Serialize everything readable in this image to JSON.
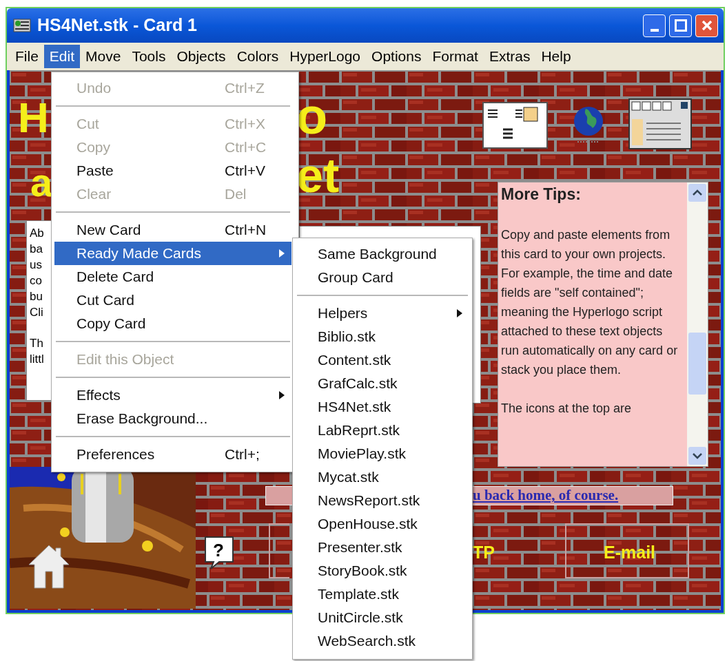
{
  "window": {
    "title": "HS4Net.stk - Card 1"
  },
  "menu_bar": [
    {
      "label": "File",
      "selected": false
    },
    {
      "label": "Edit",
      "selected": true
    },
    {
      "label": "Move",
      "selected": false
    },
    {
      "label": "Tools",
      "selected": false
    },
    {
      "label": "Objects",
      "selected": false
    },
    {
      "label": "Colors",
      "selected": false
    },
    {
      "label": "HyperLogo",
      "selected": false
    },
    {
      "label": "Options",
      "selected": false
    },
    {
      "label": "Format",
      "selected": false
    },
    {
      "label": "Extras",
      "selected": false
    },
    {
      "label": "Help",
      "selected": false
    }
  ],
  "card": {
    "title_fragments": [
      "H",
      "o",
      "a",
      "et"
    ],
    "text_field": [
      [
        "Ab",
        "ba",
        "us",
        "co",
        "bu",
        "Cli"
      ],
      [
        "Th",
        "littl"
      ]
    ],
    "tips": {
      "title": "More Tips:",
      "blocks": [
        [
          "Copy and paste elements from this card to your own projects.",
          "For example, the time and date fields are \"self contained\"; meaning the Hyperlogo script attached to these text objects run automatically on any card or stack you place them."
        ],
        [
          "The icons at the top are"
        ]
      ]
    },
    "link_text": "u back home, of course.",
    "buttons": [
      "TP",
      "E-mail"
    ],
    "help_mark": "?"
  },
  "edit_menu": {
    "items": [
      {
        "kind": "item",
        "label": "Undo",
        "shortcut": "Ctrl+Z",
        "disabled": true,
        "selected": false,
        "submenu": false
      },
      {
        "kind": "separator"
      },
      {
        "kind": "item",
        "label": "Cut",
        "shortcut": "Ctrl+X",
        "disabled": true,
        "selected": false,
        "submenu": false
      },
      {
        "kind": "item",
        "label": "Copy",
        "shortcut": "Ctrl+C",
        "disabled": true,
        "selected": false,
        "submenu": false
      },
      {
        "kind": "item",
        "label": "Paste",
        "shortcut": "Ctrl+V",
        "disabled": false,
        "selected": false,
        "submenu": false
      },
      {
        "kind": "item",
        "label": "Clear",
        "shortcut": "Del",
        "disabled": true,
        "selected": false,
        "submenu": false
      },
      {
        "kind": "separator"
      },
      {
        "kind": "item",
        "label": "New Card",
        "shortcut": "Ctrl+N",
        "disabled": false,
        "selected": false,
        "submenu": false
      },
      {
        "kind": "item",
        "label": "Ready Made Cards",
        "disabled": false,
        "selected": true,
        "submenu": true
      },
      {
        "kind": "item",
        "label": "Delete Card",
        "disabled": false,
        "selected": false,
        "submenu": false
      },
      {
        "kind": "item",
        "label": "Cut Card",
        "disabled": false,
        "selected": false,
        "submenu": false
      },
      {
        "kind": "item",
        "label": "Copy Card",
        "disabled": false,
        "selected": false,
        "submenu": false
      },
      {
        "kind": "separator"
      },
      {
        "kind": "item",
        "label": "Edit this Object",
        "disabled": true,
        "selected": false,
        "submenu": false
      },
      {
        "kind": "separator"
      },
      {
        "kind": "item",
        "label": "Effects",
        "disabled": false,
        "selected": false,
        "submenu": true
      },
      {
        "kind": "item",
        "label": "Erase Background...",
        "disabled": false,
        "selected": false,
        "submenu": false
      },
      {
        "kind": "separator"
      },
      {
        "kind": "item",
        "label": "Preferences",
        "shortcut": "Ctrl+;",
        "disabled": false,
        "selected": false,
        "submenu": false
      }
    ]
  },
  "ready_made_submenu": {
    "items": [
      {
        "kind": "item",
        "label": "Same Background",
        "selected": false,
        "submenu": false
      },
      {
        "kind": "item",
        "label": "Group Card",
        "selected": false,
        "submenu": false
      },
      {
        "kind": "separator"
      },
      {
        "kind": "item",
        "label": "Helpers",
        "selected": false,
        "submenu": true
      },
      {
        "kind": "item",
        "label": "Biblio.stk",
        "selected": false,
        "submenu": false
      },
      {
        "kind": "item",
        "label": "Content.stk",
        "selected": false,
        "submenu": false
      },
      {
        "kind": "item",
        "label": "GrafCalc.stk",
        "selected": false,
        "submenu": false
      },
      {
        "kind": "item",
        "label": "HS4Net.stk",
        "selected": false,
        "submenu": false
      },
      {
        "kind": "item",
        "label": "LabReprt.stk",
        "selected": false,
        "submenu": false
      },
      {
        "kind": "item",
        "label": "MoviePlay.stk",
        "selected": false,
        "submenu": false
      },
      {
        "kind": "item",
        "label": "Mycat.stk",
        "selected": false,
        "submenu": false
      },
      {
        "kind": "item",
        "label": "NewsReport.stk",
        "selected": false,
        "submenu": false
      },
      {
        "kind": "item",
        "label": "OpenHouse.stk",
        "selected": false,
        "submenu": false
      },
      {
        "kind": "item",
        "label": "Presenter.stk",
        "selected": false,
        "submenu": false
      },
      {
        "kind": "item",
        "label": "StoryBook.stk",
        "selected": false,
        "submenu": false
      },
      {
        "kind": "item",
        "label": "Template.stk",
        "selected": false,
        "submenu": false
      },
      {
        "kind": "item",
        "label": "UnitCircle.stk",
        "selected": false,
        "submenu": false
      },
      {
        "kind": "item",
        "label": "WebSearch.stk",
        "selected": false,
        "submenu": false
      }
    ]
  }
}
